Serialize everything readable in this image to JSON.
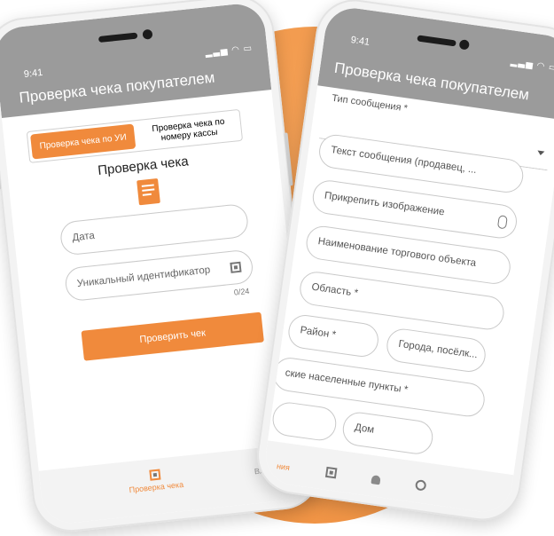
{
  "colors": {
    "accent": "#f08a3c",
    "appbar": "#9b9b9b",
    "background_blob": "#f29a4d"
  },
  "phone1": {
    "time": "9:41",
    "title": "Проверка чека покупателем",
    "tabs": [
      {
        "label": "Проверка чека по УИ",
        "active": true
      },
      {
        "label": "Проверка чека по номеру кассы",
        "active": false
      }
    ],
    "heading": "Проверка чека",
    "fields": {
      "date": "Дата",
      "uid": "Уникальный идентификатор"
    },
    "counter": "0/24",
    "button": "Проверить чек",
    "nav": [
      {
        "label": "Проверка чека",
        "icon": "qr-icon",
        "active": true
      },
      {
        "label": "Вход",
        "icon": "login-icon",
        "active": false
      }
    ]
  },
  "phone2": {
    "time": "9:41",
    "title": "Проверка чека покупателем",
    "message_type_label": "Тип сообщения *",
    "fields": {
      "message_text": "Текст сообщения (продавец, ...",
      "attach_image": "Прикрепить изображение",
      "store_name": "Наименование торгового объекта",
      "region": "Область *",
      "district": "Район *",
      "cities": "Города, посёлк...",
      "villages": "ские населенные пункты *",
      "house": "Дом"
    },
    "nav": [
      {
        "label": "ния",
        "icon": "message-icon",
        "active": true
      },
      {
        "label": "",
        "icon": "qr-icon"
      },
      {
        "label": "",
        "icon": "bell-icon"
      },
      {
        "label": "",
        "icon": "account-icon"
      }
    ]
  }
}
